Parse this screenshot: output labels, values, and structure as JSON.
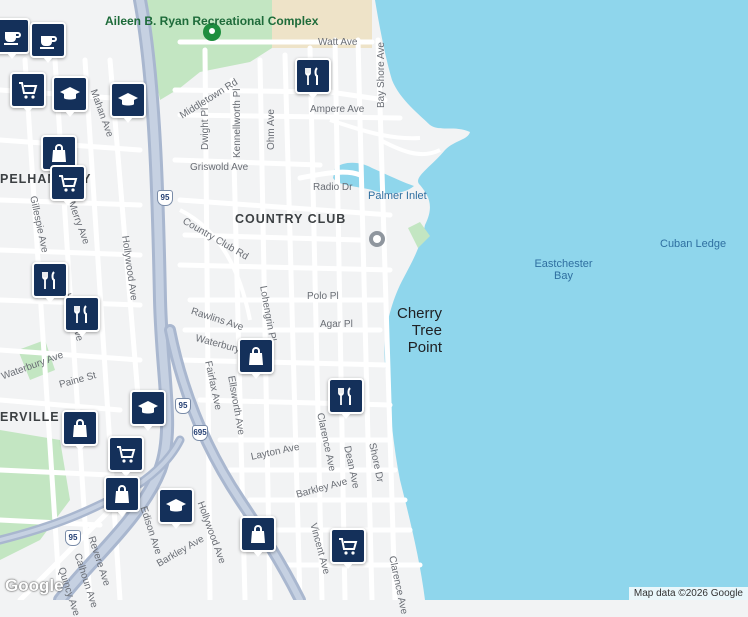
{
  "map": {
    "water_labels": [
      {
        "text": "Palmer Inlet"
      },
      {
        "text": "Eastchester Bay"
      },
      {
        "text": "Cuban Ledge"
      }
    ],
    "neighborhood": "COUNTRY CLUB",
    "neighborhood_fragment_left": "PELHAM BAY",
    "neighborhood_fragment_sw": "ERVILLE",
    "place": "Cherry Tree Point",
    "park": "Aileen B. Ryan Recreational Complex",
    "highway_shields": [
      "95",
      "95",
      "695",
      "95"
    ],
    "streets": [
      "Watt Ave",
      "Bay Shore Ave",
      "Ampere Ave",
      "Middletown Rd",
      "Dwight Pl",
      "Kennellworth Pl",
      "Ohm Ave",
      "Griswold Ave",
      "Radio Dr",
      "Country Club Rd",
      "Polo Pl",
      "Agar Pl",
      "Rawlins Ave",
      "Waterbury Ave",
      "Lohengrin Pl",
      "Fairfax Ave",
      "Ellsworth Ave",
      "Clarence Ave",
      "Dean Ave",
      "Shore Dr",
      "Layton Ave",
      "Barkley Ave",
      "Hollywood Ave",
      "Vincent Ave",
      "Mahan Ave",
      "Merry Ave",
      "Gillespie Ave",
      "Hobart Ave",
      "Paine St",
      "Revere Ave",
      "Calhoun Ave",
      "Quincy Ave",
      "Edison Ave",
      "Clarence Ave",
      "Waterbury Ave",
      "Hollywood Ave",
      "Barkley Ave"
    ],
    "poi_icons": [
      "cafe-icon",
      "cafe-icon",
      "shopping-cart-icon",
      "school-icon",
      "shopping-bag-icon",
      "restaurant-icon",
      "school-icon",
      "shopping-cart-icon",
      "restaurant-icon",
      "restaurant-icon",
      "shopping-bag-icon",
      "restaurant-icon",
      "school-icon",
      "shopping-bag-icon",
      "shopping-cart-icon",
      "school-icon",
      "shopping-bag-icon",
      "shopping-cart-icon",
      "shopping-bag-icon"
    ],
    "colors": {
      "water": "#8fd6ec",
      "land": "#f2f3f4",
      "park": "#c3e6c2",
      "highway": "#a9b7cf",
      "pin": "#14305a"
    }
  },
  "attribution": "Map data ©2026 Google",
  "logo": "Google"
}
